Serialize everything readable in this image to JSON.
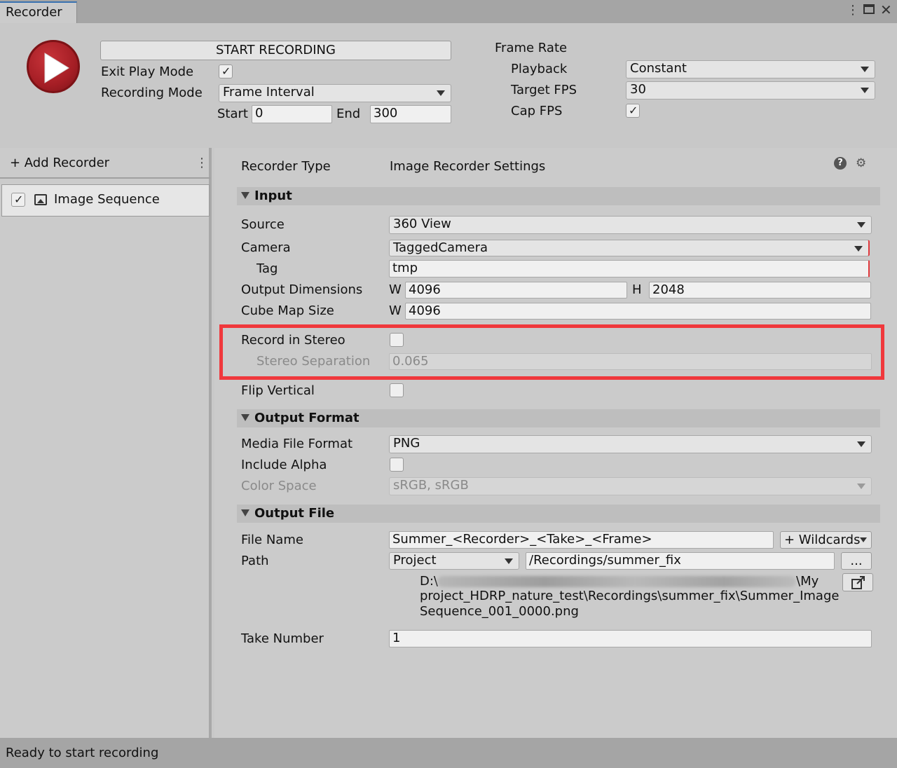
{
  "window": {
    "tab_title": "Recorder",
    "menu_icon": "kebab-icon",
    "maximize_icon": "maximize-icon",
    "close_icon": "close-icon"
  },
  "top": {
    "start_button": "START RECORDING",
    "exit_play_mode_label": "Exit Play Mode",
    "exit_play_mode_checked": true,
    "recording_mode_label": "Recording Mode",
    "recording_mode_value": "Frame Interval",
    "start_label": "Start",
    "start_value": "0",
    "end_label": "End",
    "end_value": "300",
    "frame_rate_label": "Frame Rate",
    "playback_label": "Playback",
    "playback_value": "Constant",
    "target_fps_label": "Target FPS",
    "target_fps_value": "30",
    "cap_fps_label": "Cap FPS",
    "cap_fps_checked": true
  },
  "left": {
    "add_recorder": "+ Add Recorder",
    "recorders": [
      {
        "label": "Image Sequence",
        "enabled": true,
        "icon": "image-icon"
      }
    ]
  },
  "settings": {
    "recorder_type_label": "Recorder Type",
    "recorder_type_value": "Image Recorder Settings",
    "input": {
      "header": "Input",
      "source_label": "Source",
      "source_value": "360 View",
      "camera_label": "Camera",
      "camera_value": "TaggedCamera",
      "tag_label": "Tag",
      "tag_value": "tmp",
      "output_dimensions_label": "Output Dimensions",
      "w_label": "W",
      "w_value": "4096",
      "h_label": "H",
      "h_value": "2048",
      "cube_map_label": "Cube Map Size",
      "cube_w_label": "W",
      "cube_w_value": "4096",
      "record_stereo_label": "Record in Stereo",
      "record_stereo_checked": false,
      "stereo_separation_label": "Stereo Separation",
      "stereo_separation_value": "0.065",
      "flip_vertical_label": "Flip Vertical",
      "flip_vertical_checked": false
    },
    "output_format": {
      "header": "Output Format",
      "media_format_label": "Media File Format",
      "media_format_value": "PNG",
      "include_alpha_label": "Include Alpha",
      "include_alpha_checked": false,
      "color_space_label": "Color Space",
      "color_space_value": "sRGB, sRGB"
    },
    "output_file": {
      "header": "Output File",
      "file_name_label": "File Name",
      "file_name_value": "Summer_<Recorder>_<Take>_<Frame>",
      "wildcards_button": "+ Wildcards",
      "path_label": "Path",
      "path_root_value": "Project",
      "path_value": "/Recordings/summer_fix",
      "browse_button": "...",
      "resolved_path_line1_prefix": "D:\\",
      "resolved_path_line1_suffix": "\\My",
      "resolved_path_line2": "project_HDRP_nature_test\\Recordings\\summer_fix\\Summer_Image",
      "resolved_path_line3": "Sequence_001_0000.png",
      "open_folder_icon": "external-link-icon",
      "take_number_label": "Take Number",
      "take_number_value": "1"
    }
  },
  "status": {
    "text": "Ready to start recording"
  }
}
